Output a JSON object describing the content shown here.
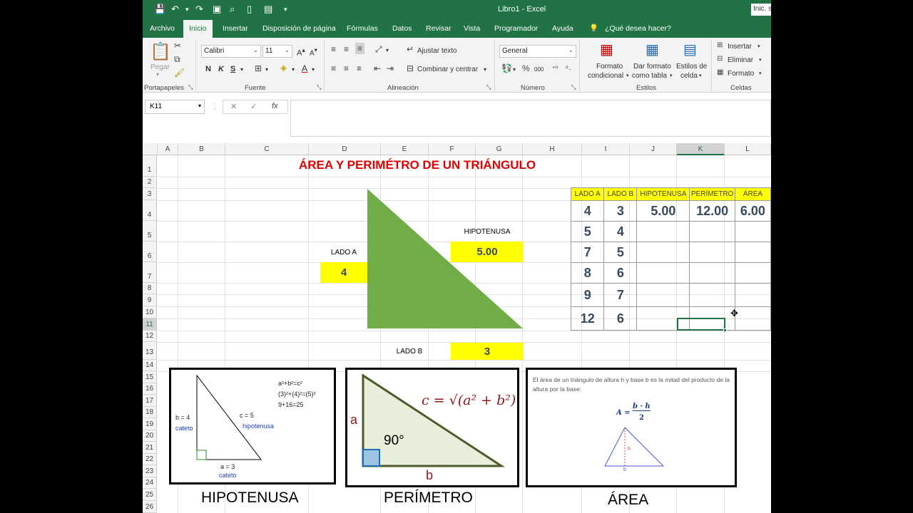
{
  "window": {
    "title": "Libro1  -  Excel",
    "signin": "Inic. s"
  },
  "tabs": [
    "Archivo",
    "Inicio",
    "Insertar",
    "Disposición de página",
    "Fórmulas",
    "Datos",
    "Revisar",
    "Vista",
    "Programador",
    "Ayuda",
    "¿Qué desea hacer?"
  ],
  "ribbon": {
    "paste_label": "Pegar",
    "font_name": "Calibri",
    "font_size": "11",
    "bold": "N",
    "italic": "K",
    "underline": "S",
    "wrap_text": "Ajustar texto",
    "merge_center": "Combinar y centrar",
    "number_format": "General",
    "cond_format_1": "Formato",
    "cond_format_2": "condicional",
    "table_format_1": "Dar formato",
    "table_format_2": "como tabla",
    "cell_styles_1": "Estilos de",
    "cell_styles_2": "celda",
    "insert": "Insertar",
    "delete": "Eliminar",
    "format": "Formato",
    "groups": [
      "Portapapeles",
      "Fuente",
      "Alineación",
      "Número",
      "Estilos",
      "Celdas"
    ]
  },
  "formula_bar": {
    "name_box": "K11",
    "fx": "fx",
    "formula": ""
  },
  "columns": [
    "A",
    "B",
    "C",
    "D",
    "E",
    "F",
    "G",
    "H",
    "I",
    "J",
    "K",
    "L"
  ],
  "rows": [
    "1",
    "2",
    "3",
    "4",
    "5",
    "6",
    "7",
    "8",
    "9",
    "10",
    "11",
    "12",
    "13",
    "14",
    "15",
    "16",
    "17",
    "18",
    "19",
    "20",
    "21",
    "22",
    "23",
    "24",
    "25",
    "26"
  ],
  "sheet": {
    "title": "ÁREA Y PERIMÉTRO DE UN TRIÁNGULO",
    "lado_a_label": "LADO A",
    "lado_a_value": "4",
    "lado_b_label": "LADO B",
    "lado_b_value": "3",
    "hipotenusa_label": "HIPOTENUSA",
    "hipotenusa_value": "5.00",
    "triangle_color": "#70ad47"
  },
  "table": {
    "headers": [
      "LADO A",
      "LADO B",
      "HIPOTENUSA",
      "PERÍMETRO",
      "ÁREA"
    ],
    "rows": [
      [
        "4",
        "3",
        "5.00",
        "12.00",
        "6.00"
      ],
      [
        "5",
        "4",
        "",
        "",
        ""
      ],
      [
        "7",
        "5",
        "",
        "",
        ""
      ],
      [
        "8",
        "6",
        "",
        "",
        ""
      ],
      [
        "9",
        "7",
        "",
        "",
        ""
      ],
      [
        "12",
        "6",
        "",
        "",
        ""
      ]
    ]
  },
  "images": {
    "hip": {
      "eq1": "a²+b²=c²",
      "eq2": "(3)²+(4)²=(5)²",
      "eq3": "9+16=25",
      "b": "b = 4",
      "cateto_b": "cateto",
      "c": "c = 5",
      "hip": "hipotenusa",
      "a": "a = 3",
      "cateto_a": "cateto"
    },
    "per": {
      "formula": "c = √(a² + b²)",
      "a": "a",
      "b": "b",
      "angle": "90°"
    },
    "area": {
      "text": "El área de un triángulo de altura h y base b es la mitad del producto de la altura por la base:",
      "formula_lhs": "A =",
      "num": "b · h",
      "den": "2",
      "h": "h",
      "b": "b"
    }
  },
  "captions": [
    "HIPOTENUSA",
    "PERÍMETRO",
    "ÁREA"
  ]
}
